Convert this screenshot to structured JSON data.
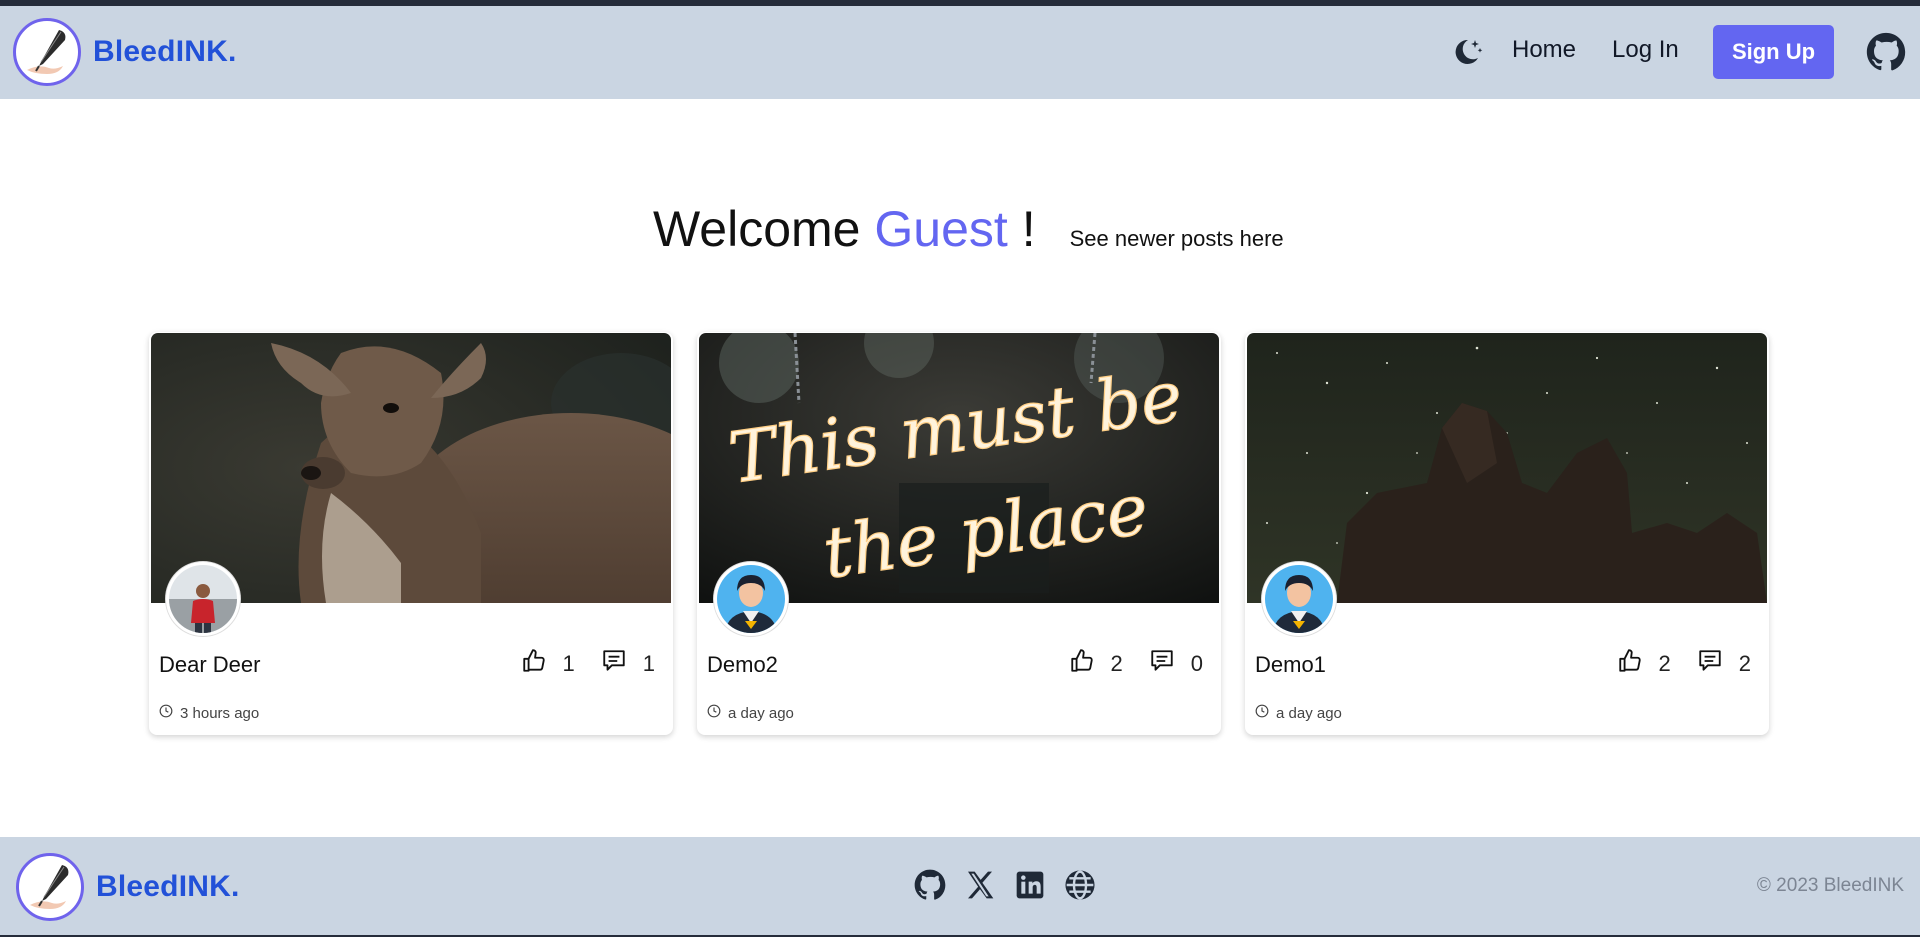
{
  "app": {
    "brand": "BleedINK.",
    "accent": "#6366f1",
    "brand_color": "#2251d8",
    "bar_color": "#cad5e2"
  },
  "nav": {
    "theme_icon": "moon-stars-icon",
    "home": "Home",
    "login": "Log In",
    "signup": "Sign Up",
    "github_icon": "github-icon"
  },
  "hero": {
    "welcome": "Welcome",
    "user": "Guest",
    "exclaim": "!",
    "newer_link": "See newer posts here"
  },
  "posts": [
    {
      "title": "Dear Deer",
      "likes": "1",
      "comments": "1",
      "time": "3 hours ago",
      "image": "deer-photo",
      "avatar": "user-photo-avatar"
    },
    {
      "title": "Demo2",
      "likes": "2",
      "comments": "0",
      "time": "a day ago",
      "image": "neon-sign-photo",
      "image_text": "This must be the place",
      "avatar": "cartoon-avatar"
    },
    {
      "title": "Demo1",
      "likes": "2",
      "comments": "2",
      "time": "a day ago",
      "image": "starry-night-rocks-photo",
      "avatar": "cartoon-avatar"
    }
  ],
  "footer": {
    "brand": "BleedINK.",
    "icons": [
      "github-icon",
      "x-icon",
      "linkedin-icon",
      "globe-icon"
    ],
    "copyright": "© 2023 BleedINK"
  }
}
